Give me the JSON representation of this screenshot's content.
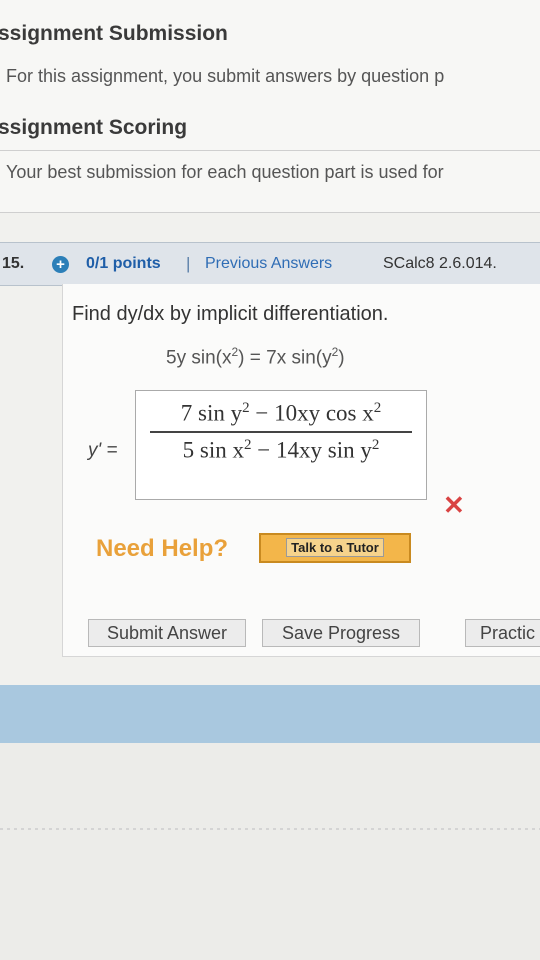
{
  "sections": [
    {
      "heading": "ssignment Submission",
      "text": "For this assignment, you submit answers by question p"
    },
    {
      "heading": "ssignment Scoring",
      "text": "Your best submission for each question part is used for"
    }
  ],
  "question": {
    "number": "15.",
    "points": "0/1 points",
    "separator": "|",
    "previous_answers": "Previous Answers",
    "reference": "SCalc8 2.6.014.",
    "instruction": "Find dy/dx by implicit differentiation.",
    "equation": {
      "left": "5y sin(x",
      "left_exp": "2",
      "mid": ") = 7x sin(y",
      "right_exp": "2",
      "end": ")"
    },
    "answer_label": "y' =",
    "answer": {
      "num_a": "7 sin y",
      "num_a_exp": "2",
      "num_b": " − 10xy cos x",
      "num_b_exp": "2",
      "den_a": "5 sin x",
      "den_a_exp": "2",
      "den_b": " − 14xy sin y",
      "den_b_exp": "2"
    },
    "incorrect_mark": "✕"
  },
  "help": {
    "label": "Need Help?",
    "tutor_button": "Talk to a Tutor"
  },
  "actions": {
    "submit": "Submit Answer",
    "save": "Save Progress",
    "practice": "Practic"
  },
  "colors": {
    "link": "#2f6db5",
    "help": "#e9a13a",
    "incorrect": "#d94343",
    "band": "#a9c8df"
  }
}
